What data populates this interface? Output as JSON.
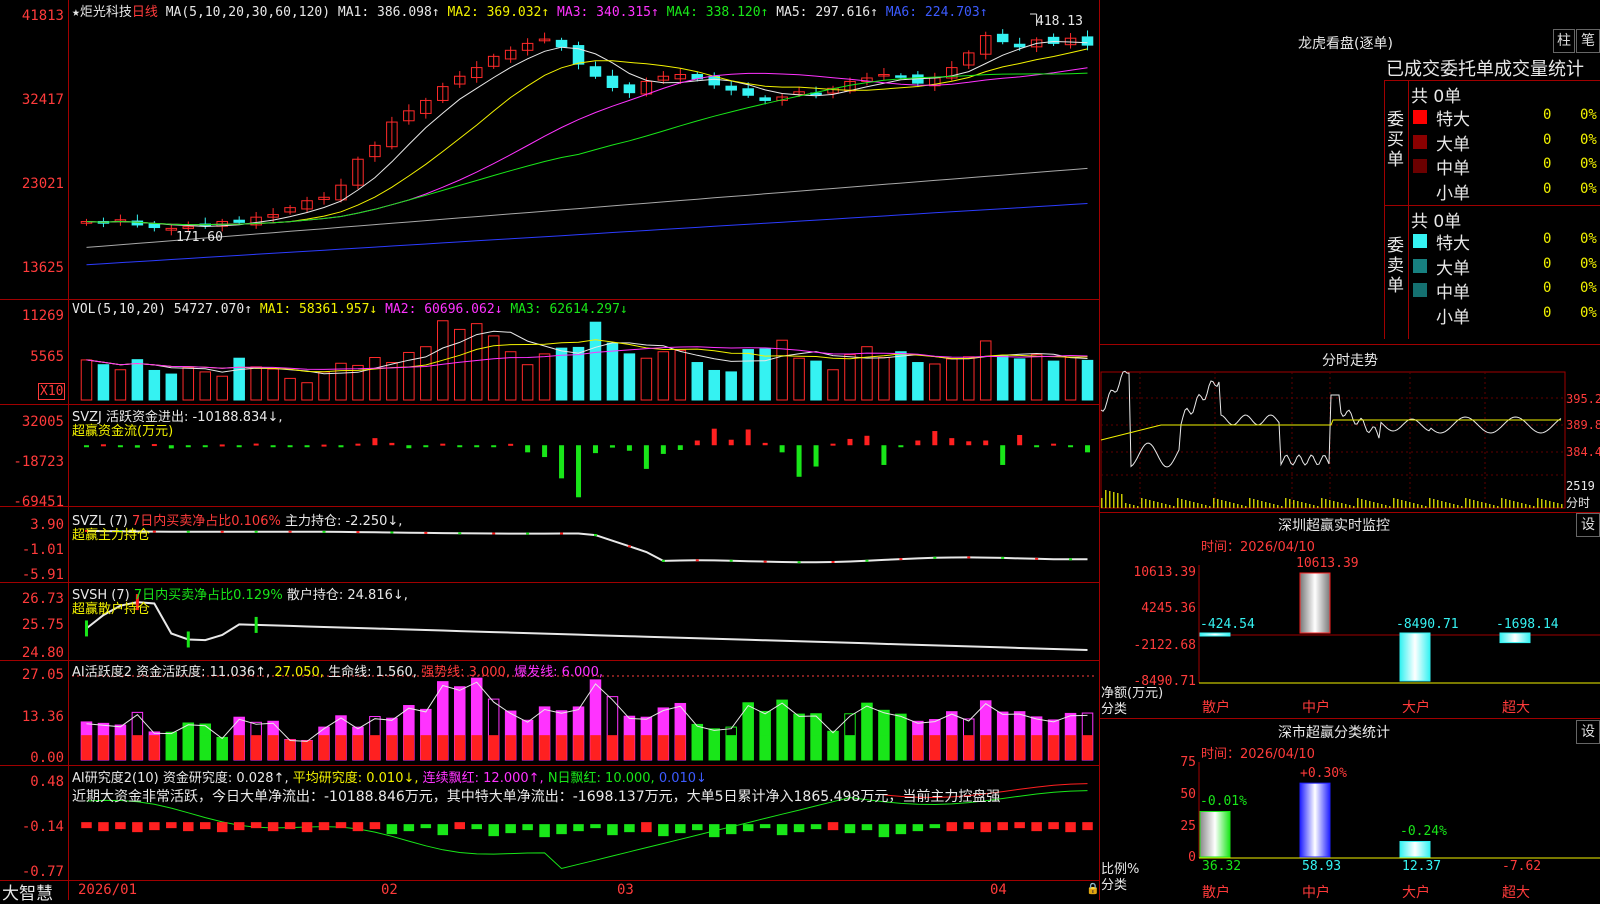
{
  "stock": {
    "star": "★",
    "name": "炬光科技",
    "period": "日线",
    "ma_def": "MA(5,10,20,30,60,120)",
    "ma1": "MA1: 386.098↑",
    "ma2": "MA2: 369.032↑",
    "ma3": "MA3: 340.315↑",
    "ma4": "MA4: 338.120↑",
    "ma5": "MA5: 297.616↑",
    "ma6": "MA6: 224.703↑",
    "hi_mark": "418.13",
    "lo_mark": "171.60"
  },
  "price_axis": [
    "41813",
    "32417",
    "23021",
    "13625"
  ],
  "vol": {
    "def": "VOL(5,10,20)",
    "val": "54727.070↑",
    "ma1": "MA1: 58361.957↓",
    "ma2": "MA2: 60696.062↓",
    "ma3": "MA3: 62614.297↓",
    "axis": [
      "11269",
      "5565"
    ],
    "unit": "X10"
  },
  "svzj": {
    "line1": "SVZJ  活跃资金进出: -10188.834↓,",
    "line2": "超赢资金流(万元)",
    "axis": [
      "32005",
      "-18723",
      "-69451"
    ]
  },
  "svzl": {
    "def": "SVZL (7)",
    "desc": "7日内买卖净占比0.106%",
    "val": "主力持仓: -2.250↓,",
    "line2": "超赢主力持仓",
    "axis": [
      "3.90",
      "-1.01",
      "-5.91"
    ]
  },
  "svsh": {
    "def": "SVSH (7)",
    "desc": "7日内买卖净占比0.129%",
    "val": "散户持仓: 24.816↓,",
    "line2": "超赢散户持仓",
    "axis": [
      "26.73",
      "25.75",
      "24.80"
    ]
  },
  "ai2": {
    "def": "AI活跃度2",
    "v1": "资金活跃度: 11.036↑,",
    "v2": "27.050,",
    "v3": "生命线: 1.560,",
    "v4": "强势线: 3.000,",
    "v5": "爆发线: 6.000,",
    "axis": [
      "27.05",
      "13.36",
      "0.00"
    ]
  },
  "ai_res": {
    "def": "AI研究度2(10)",
    "v1": "资金研究度: 0.028↑,",
    "v2": "平均研究度: 0.010↓,",
    "v3": "连续飘红: 12.000↑,",
    "v4": "N日飘红: 10.000,",
    "v5": "0.010↓",
    "comment": "近期大资金非常活跃，今日大单净流出：-10188.846万元，其中特大单净流出：-1698.137万元，大单5日累计净入1865.498万元，当前主力控盘强",
    "axis": [
      "0.48",
      "-0.14",
      "-0.77"
    ]
  },
  "xaxis": {
    "logo": "大智慧",
    "labels": [
      "2026/01",
      "02",
      "03",
      "04"
    ]
  },
  "dragon": {
    "title": "龙虎看盘(逐单)",
    "btn1": "柱",
    "btn2": "笔",
    "subtitle": "已成交委托单成交量统计",
    "buy_label": "委买单",
    "buy_total": "共 0单",
    "sell_label": "委卖单",
    "sell_total": "共 0单",
    "buy_rows": [
      {
        "name": "特大",
        "qty": "0",
        "pct": "0%",
        "color": "#ff0000"
      },
      {
        "name": "大单",
        "qty": "0",
        "pct": "0%",
        "color": "#8b0000"
      },
      {
        "name": "中单",
        "qty": "0",
        "pct": "0%",
        "color": "#6b0000"
      },
      {
        "name": "小单",
        "qty": "0",
        "pct": "0%",
        "color": "#000000"
      }
    ],
    "sell_rows": [
      {
        "name": "特大",
        "qty": "0",
        "pct": "0%",
        "color": "#35f2f2"
      },
      {
        "name": "大单",
        "qty": "0",
        "pct": "0%",
        "color": "#178080"
      },
      {
        "name": "中单",
        "qty": "0",
        "pct": "0%",
        "color": "#147070"
      },
      {
        "name": "小单",
        "qty": "0",
        "pct": "0%",
        "color": "#000000"
      }
    ]
  },
  "intraday": {
    "title": "分时走势",
    "axis": [
      "395.2",
      "389.8",
      "384.4"
    ],
    "vol_label": "2519",
    "vol_unit": "分时"
  },
  "monitor": {
    "title": "深圳超赢实时监控",
    "btn": "设",
    "time": "时间：2026/04/10",
    "axis": [
      "10613.39",
      "4245.36",
      "-2122.68",
      "-8490.71"
    ],
    "ylabel": "净额(万元)",
    "xcat": "分类",
    "categories": [
      "散户",
      "中户",
      "大户",
      "超大"
    ],
    "values_label": [
      "-424.54",
      "10613.39",
      "-8490.71",
      "-1698.14"
    ]
  },
  "classify": {
    "title": "深市超赢分类统计",
    "btn": "设",
    "time": "时间：2026/04/10",
    "axis": [
      "75",
      "50",
      "25",
      "0"
    ],
    "ylabel": "比例%",
    "xcat": "分类",
    "categories": [
      "散户",
      "中户",
      "大户",
      "超大"
    ],
    "top_labels": [
      "-0.01%",
      "+0.30%",
      "-0.24%",
      ""
    ],
    "bottom_labels": [
      "36.32",
      "58.93",
      "12.37",
      "-7.62"
    ]
  },
  "chart_data": [
    {
      "type": "candlestick",
      "title": "炬光科技 日线",
      "ylim": [
        13625,
        41813
      ],
      "x": [
        "2026/01",
        "02",
        "03",
        "04"
      ],
      "series": [
        {
          "name": "MA1",
          "value": 386.098
        },
        {
          "name": "MA2",
          "value": 369.032
        },
        {
          "name": "MA3",
          "value": 340.315
        },
        {
          "name": "MA4",
          "value": 338.12
        },
        {
          "name": "MA5",
          "value": 297.616
        },
        {
          "name": "MA6",
          "value": 224.703
        }
      ],
      "closes": [
        190,
        188,
        192,
        186,
        183,
        182,
        184,
        186,
        190,
        189,
        195,
        198,
        206,
        214,
        218,
        232,
        262,
        278,
        305,
        318,
        330,
        346,
        358,
        368,
        381,
        388,
        396,
        401,
        392,
        372,
        358,
        345,
        339,
        352,
        358,
        360,
        355,
        348,
        342,
        336,
        330,
        334,
        340,
        337,
        344,
        352,
        356,
        360,
        358,
        350,
        356,
        368,
        385,
        405,
        398,
        392,
        400,
        396,
        402,
        394
      ]
    },
    {
      "type": "bar",
      "title": "VOL(5,10,20)",
      "ylim": [
        0,
        11269
      ],
      "values": [
        5565,
        4900,
        4200,
        5600,
        4100,
        3600,
        4500,
        3900,
        3300,
        5800,
        4600,
        4300,
        3000,
        2400,
        3900,
        5100,
        4800,
        5900,
        5200,
        6600,
        7400,
        11000,
        9800,
        10600,
        8900,
        6700,
        4900,
        6400,
        7200,
        7300,
        10800,
        7900,
        6400,
        5800,
        6700,
        6900,
        5200,
        4100,
        3900,
        7000,
        7100,
        8300,
        5800,
        5400,
        4200,
        6300,
        7400,
        5900,
        6700,
        5200,
        5000,
        5700,
        6000,
        8200,
        6100,
        5700,
        6300,
        5400,
        5900,
        5500
      ]
    },
    {
      "type": "bar",
      "title": "超赢资金流(万元)",
      "ylim": [
        -69451,
        32005
      ],
      "values": [
        -2000,
        1200,
        -800,
        -3000,
        1500,
        -4000,
        -1800,
        -2500,
        1000,
        -700,
        2100,
        -1500,
        -900,
        -1200,
        800,
        -2600,
        2000,
        9000,
        3000,
        -3800,
        -1200,
        2000,
        -900,
        -2200,
        -1800,
        1800,
        -9000,
        -15000,
        -42000,
        -66000,
        -10000,
        -3000,
        -7000,
        -30000,
        -11000,
        -6000,
        6000,
        21000,
        7000,
        20000,
        3000,
        -9000,
        -40000,
        -27000,
        2000,
        8000,
        12000,
        -25000,
        -800,
        6000,
        18000,
        9000,
        5000,
        6000,
        -25000,
        13000,
        -500,
        2000,
        -800,
        -9000
      ]
    }
  ]
}
